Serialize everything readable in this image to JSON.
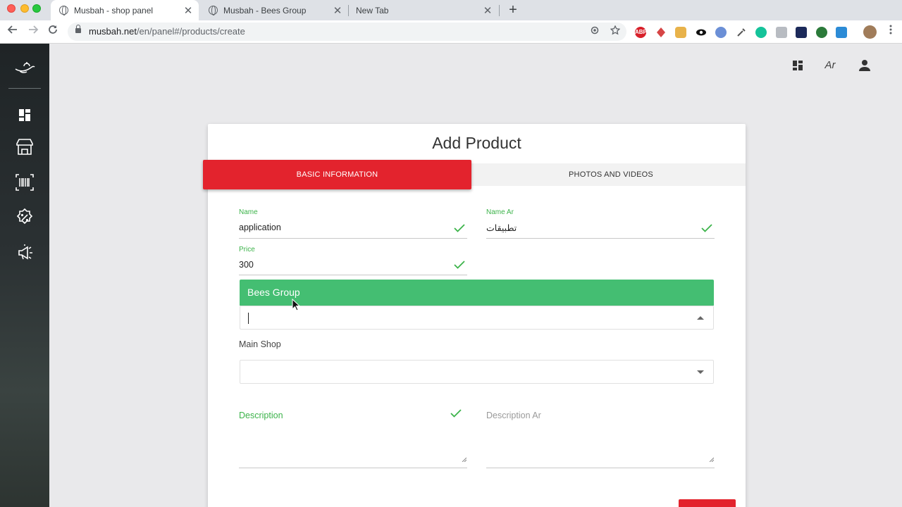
{
  "browser": {
    "tabs": [
      {
        "title": "Musbah - shop panel",
        "close": "✕"
      },
      {
        "title": "Musbah - Bees Group",
        "close": "✕"
      },
      {
        "title": "New Tab",
        "close": "✕"
      }
    ],
    "new_tab": "+",
    "url_host": "musbah.net",
    "url_path": "/en/panel#/products/create",
    "extensions": [
      "ABP"
    ]
  },
  "header": {
    "lang_label": "Ar"
  },
  "card": {
    "title": "Add Product",
    "tabs": [
      {
        "label": "BASIC INFORMATION",
        "active": true
      },
      {
        "label": "PHOTOS AND VIDEOS",
        "active": false
      }
    ],
    "fields": {
      "name": {
        "label": "Name",
        "value": "application"
      },
      "name_ar": {
        "label": "Name Ar",
        "value": "تطبيقات"
      },
      "price": {
        "label": "Price",
        "value": "300"
      }
    },
    "group_select": {
      "highlighted_option": "Bees Group",
      "value": ""
    },
    "main_shop": {
      "label": "Main Shop",
      "value": ""
    },
    "description": {
      "label": "Description",
      "value": ""
    },
    "description_ar": {
      "label": "Description Ar",
      "value": ""
    }
  },
  "colors": {
    "accent_red": "#e3232d",
    "valid_green": "#3cb34a",
    "option_green": "#44be72"
  }
}
